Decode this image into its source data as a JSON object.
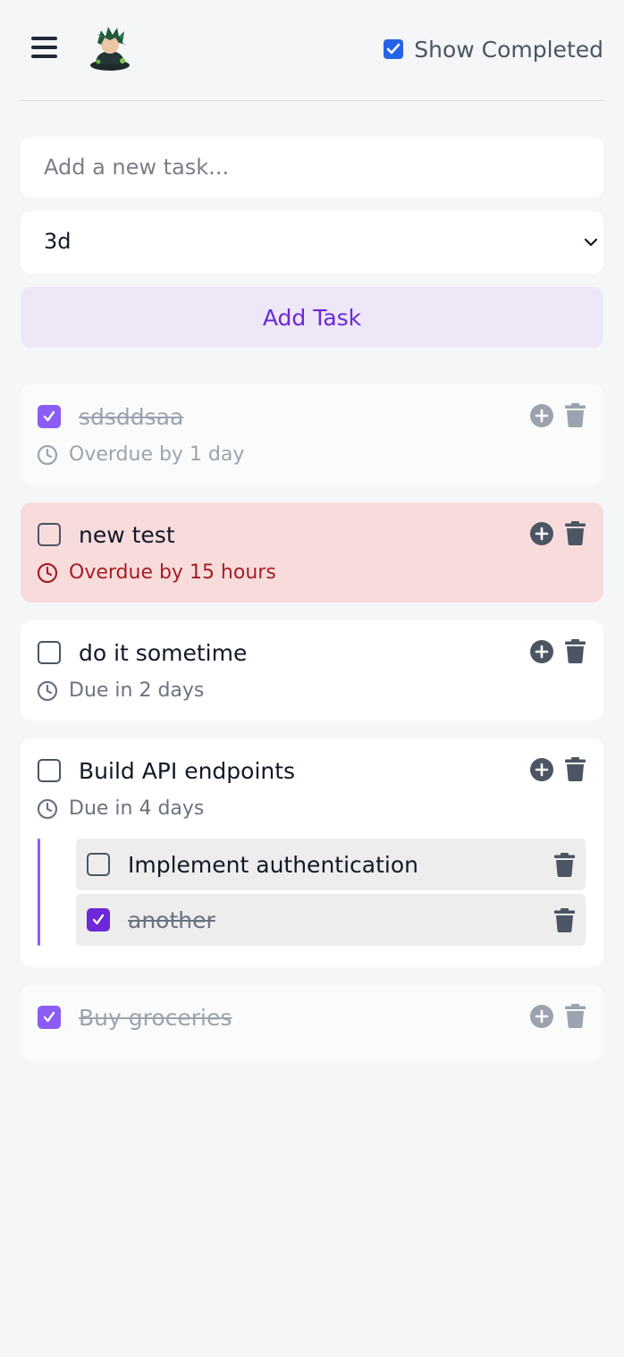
{
  "header": {
    "show_completed_label": "Show Completed",
    "show_completed_checked": true
  },
  "form": {
    "placeholder": "Add a new task...",
    "due_selected": "3d",
    "add_label": "Add Task"
  },
  "tasks": [
    {
      "title": "sdsddsaa",
      "completed": true,
      "due": "Overdue by 1 day",
      "overdue": false
    },
    {
      "title": "new test",
      "completed": false,
      "due": "Overdue by 15 hours",
      "overdue": true
    },
    {
      "title": "do it sometime",
      "completed": false,
      "due": "Due in 2 days",
      "overdue": false
    },
    {
      "title": "Build API endpoints",
      "completed": false,
      "due": "Due in 4 days",
      "overdue": false,
      "subtasks": [
        {
          "title": "Implement authentication",
          "completed": false
        },
        {
          "title": "another",
          "completed": true
        }
      ]
    },
    {
      "title": "Buy groceries",
      "completed": true,
      "overdue": false
    }
  ],
  "colors": {
    "accent": "#8b5cf6",
    "accent_dark": "#6d28d9",
    "overdue_bg": "#f8dcdc",
    "overdue_text": "#a61d24",
    "checkbox_blue": "#2563eb"
  },
  "icons": [
    "menu-icon",
    "avatar-logo",
    "check-icon",
    "chevron-down-icon",
    "clock-icon",
    "plus-circle-icon",
    "trash-icon"
  ]
}
